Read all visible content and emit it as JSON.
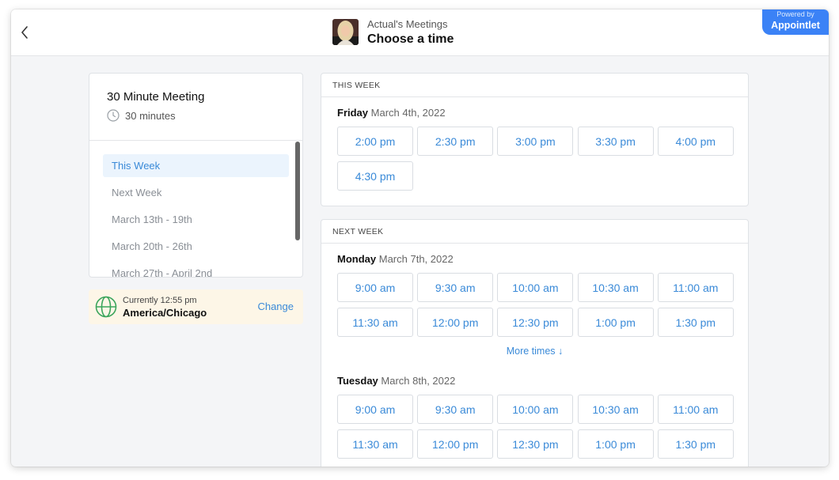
{
  "header": {
    "subtitle": "Actual's Meetings",
    "title": "Choose a time",
    "powered_small": "Powered by",
    "powered_brand": "Appointlet"
  },
  "meeting": {
    "title": "30 Minute Meeting",
    "duration": "30 minutes"
  },
  "weeks": [
    {
      "label": "This Week",
      "active": true
    },
    {
      "label": "Next Week"
    },
    {
      "label": "March 13th - 19th"
    },
    {
      "label": "March 20th - 26th"
    },
    {
      "label": "March 27th - April 2nd"
    }
  ],
  "timezone": {
    "current": "Currently 12:55 pm",
    "name": "America/Chicago",
    "change_label": "Change"
  },
  "this_week": {
    "heading": "THIS WEEK",
    "day_name": "Friday",
    "day_date": "March 4th, 2022",
    "slots": [
      "2:00 pm",
      "2:30 pm",
      "3:00 pm",
      "3:30 pm",
      "4:00 pm",
      "4:30 pm"
    ]
  },
  "next_week": {
    "heading": "NEXT WEEK",
    "monday": {
      "day_name": "Monday",
      "day_date": "March 7th, 2022",
      "slots": [
        "9:00 am",
        "9:30 am",
        "10:00 am",
        "10:30 am",
        "11:00 am",
        "11:30 am",
        "12:00 pm",
        "12:30 pm",
        "1:00 pm",
        "1:30 pm"
      ]
    },
    "more_times": "More times ↓",
    "tuesday": {
      "day_name": "Tuesday",
      "day_date": "March 8th, 2022",
      "slots": [
        "9:00 am",
        "9:30 am",
        "10:00 am",
        "10:30 am",
        "11:00 am",
        "11:30 am",
        "12:00 pm",
        "12:30 pm",
        "1:00 pm",
        "1:30 pm"
      ]
    }
  },
  "colors": {
    "accent": "#3a8ad8",
    "brand": "#3b82f6",
    "timezone_bg": "#fdf6e7",
    "active_bg": "#ebf4fd"
  }
}
